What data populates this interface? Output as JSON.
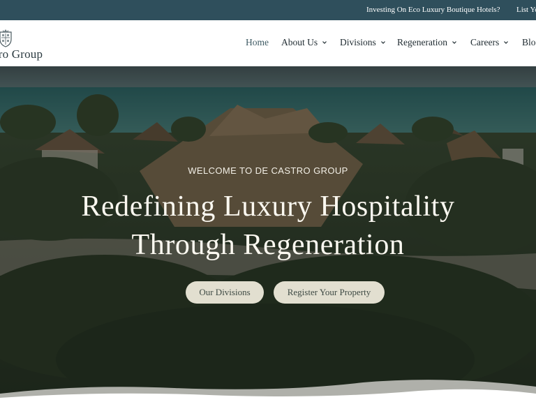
{
  "topbar": {
    "invest_link": "Investing On Eco Luxury Boutique Hotels?",
    "list_link": "List Yo"
  },
  "logo": {
    "text": "stro Group"
  },
  "nav": {
    "items": [
      {
        "label": "Home",
        "active": true
      },
      {
        "label": "About Us",
        "dropdown": true
      },
      {
        "label": "Divisions",
        "dropdown": true
      },
      {
        "label": "Regeneration",
        "dropdown": true
      },
      {
        "label": "Careers",
        "dropdown": true
      },
      {
        "label": "Blog"
      }
    ]
  },
  "hero": {
    "eyebrow": "WELCOME TO DE CASTRO GROUP",
    "headline_line1": "Redefining Luxury Hospitality",
    "headline_line2": "Through Regeneration",
    "button_divisions": "Our Divisions",
    "button_register": "Register Your Property"
  },
  "colors": {
    "topbar_bg": "#2f4f5c",
    "button_bg": "#e2dfd0",
    "text_dark": "#1e2a30"
  }
}
